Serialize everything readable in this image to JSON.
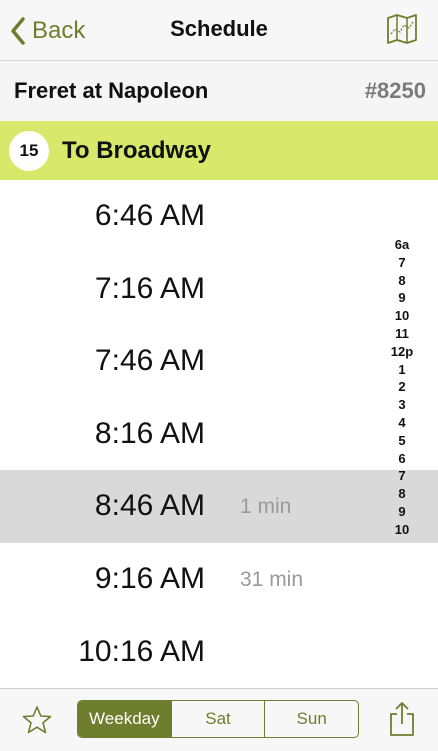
{
  "nav": {
    "back_label": "Back",
    "title": "Schedule",
    "map_icon": "map-icon"
  },
  "stop": {
    "name": "Freret at Napoleon",
    "id": "#8250"
  },
  "route": {
    "number": "15",
    "destination": "To Broadway",
    "color": "#d8e86a"
  },
  "times": [
    {
      "time": "6:46 AM",
      "wait": ""
    },
    {
      "time": "7:16 AM",
      "wait": ""
    },
    {
      "time": "7:46 AM",
      "wait": ""
    },
    {
      "time": "8:16 AM",
      "wait": ""
    },
    {
      "time": "8:46 AM",
      "wait": "1 min"
    },
    {
      "time": "9:16 AM",
      "wait": "31 min"
    },
    {
      "time": "10:16 AM",
      "wait": ""
    }
  ],
  "highlighted_index": 4,
  "hour_index": [
    "6a",
    "7",
    "8",
    "9",
    "10",
    "11",
    "12p",
    "1",
    "2",
    "3",
    "4",
    "5",
    "6",
    "7",
    "8",
    "9",
    "10"
  ],
  "toolbar": {
    "segments": [
      "Weekday",
      "Sat",
      "Sun"
    ],
    "active_segment": "Weekday",
    "favorite_icon": "star-icon",
    "share_icon": "share-icon"
  },
  "colors": {
    "accent": "#6f7d2e",
    "highlight_row": "#d9d9d9",
    "wait_text": "#9a9a9a"
  }
}
